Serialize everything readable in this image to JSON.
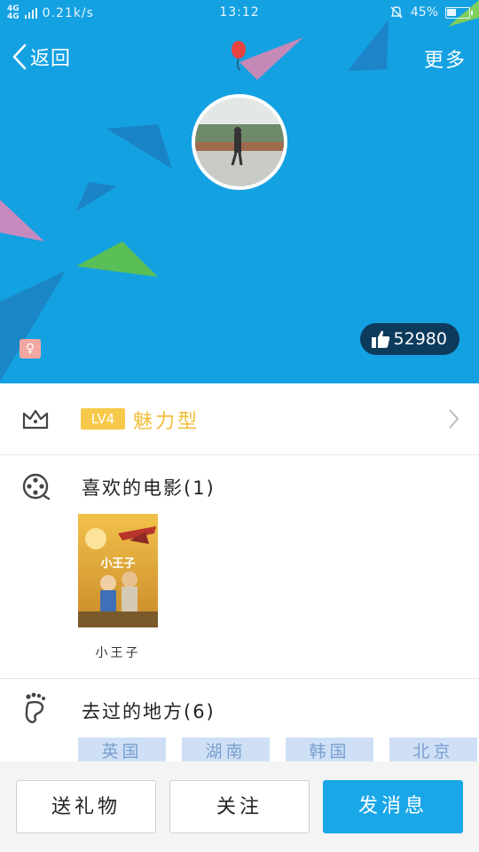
{
  "status_bar": {
    "network": "4G",
    "network2": "4G",
    "speed": "0.21k/s",
    "time": "13:12",
    "battery_text": "45%",
    "battery_level": 0.45
  },
  "header": {
    "back_label": "返回",
    "more_label": "更多",
    "likes_count": "52980"
  },
  "level": {
    "badge": "LV4",
    "label": "魅力型"
  },
  "movies": {
    "title": "喜欢的电影(1)",
    "items": [
      {
        "title": "小王子",
        "poster_text": "小王子"
      }
    ]
  },
  "places": {
    "title": "去过的地方(6)",
    "tags": [
      "英国",
      "湖南",
      "韩国",
      "北京"
    ]
  },
  "actions": {
    "gift": "送礼物",
    "follow": "关注",
    "message": "发消息"
  },
  "colors": {
    "header_bg": "#14a1e2",
    "level_accent": "#f2bf3b",
    "primary_button": "#1aa7e8",
    "tag_bg": "#cfe0f6"
  }
}
